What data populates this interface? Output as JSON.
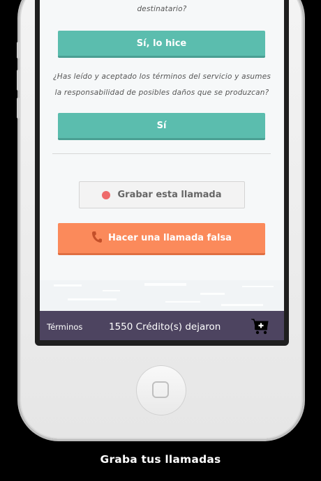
{
  "content": {
    "question_1_tail": "destinatario?",
    "confirm_button": "Sí, lo hice",
    "question_2_line1": "¿Has leído y aceptado los términos del servicio y asumes",
    "question_2_line2": "la responsabilidad de posibles daños que se produzcan?",
    "accept_button": "Sí",
    "record_button": "Grabar esta llamada",
    "fake_call_button": "Hacer una llamada falsa"
  },
  "footer": {
    "terms_link": "Términos",
    "credits_text": "1550 Crédito(s) dejaron"
  },
  "icons": {
    "record": "record-dot-icon",
    "phone": "phone-icon",
    "cart": "cart-add-icon"
  },
  "colors": {
    "teal": "#5bbdae",
    "orange": "#fb8a5b",
    "record_dot": "#ee6a6a",
    "footer_bg": "#4d4460"
  },
  "caption": "Graba tus llamadas"
}
